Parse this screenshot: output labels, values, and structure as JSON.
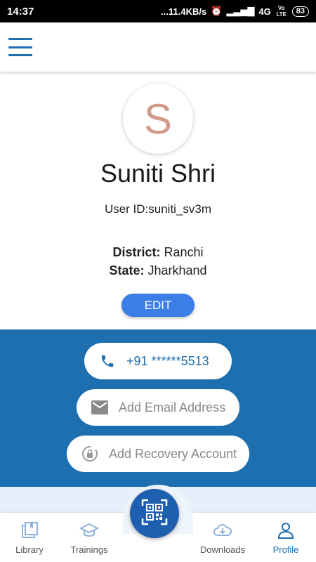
{
  "status_bar": {
    "time": "14:37",
    "network_speed": "...11.4KB/s",
    "network_type": "4G",
    "lte": "Vo LTE",
    "battery": "83"
  },
  "profile": {
    "avatar_letter": "S",
    "name": "Suniti Shri",
    "user_id": "User ID:suniti_sv3m",
    "district_label": "District:",
    "district_value": "Ranchi",
    "state_label": "State:",
    "state_value": "Jharkhand",
    "edit_label": "EDIT"
  },
  "contact": {
    "phone": "+91 ******5513",
    "email_placeholder": "Add Email Address",
    "recovery_placeholder": "Add Recovery Account"
  },
  "bottom_nav": {
    "library": "Library",
    "trainings": "Trainings",
    "downloads": "Downloads",
    "profile": "Profile"
  },
  "colors": {
    "primary": "#1e6fb0",
    "edit_button": "#3b7ee8",
    "avatar_letter": "#d39a88"
  }
}
